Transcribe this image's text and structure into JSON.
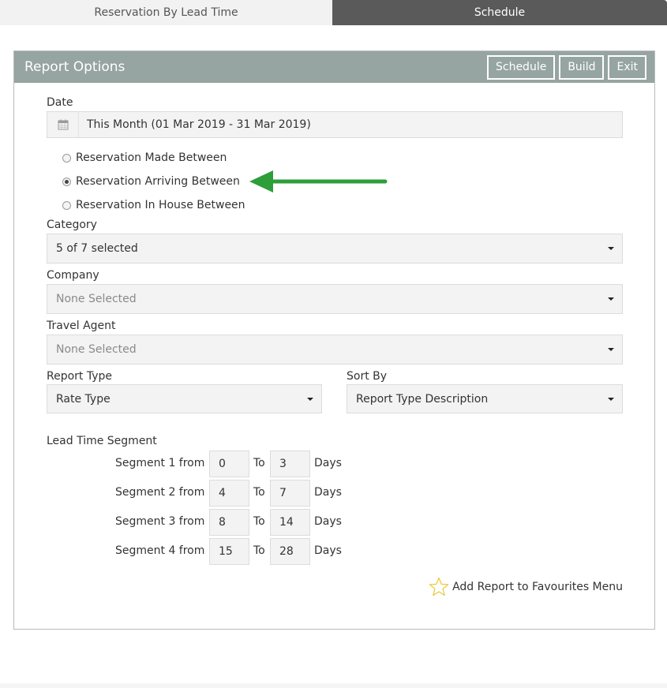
{
  "tabs": [
    {
      "label": "Reservation By Lead Time",
      "active": false
    },
    {
      "label": "Schedule",
      "active": true
    }
  ],
  "panel": {
    "title": "Report Options",
    "buttons": {
      "schedule": "Schedule",
      "build": "Build",
      "exit": "Exit"
    }
  },
  "date": {
    "label": "Date",
    "icon": "calendar-icon",
    "value": "This Month (01 Mar 2019 - 31 Mar 2019)"
  },
  "date_mode": {
    "options": [
      {
        "label": "Reservation Made Between",
        "checked": false
      },
      {
        "label": "Reservation Arriving Between",
        "checked": true
      },
      {
        "label": "Reservation In House Between",
        "checked": false
      }
    ],
    "annotation": "green-arrow-icon"
  },
  "category": {
    "label": "Category",
    "value": "5 of 7 selected"
  },
  "company": {
    "label": "Company",
    "placeholder": "None Selected"
  },
  "travel_agent": {
    "label": "Travel Agent",
    "placeholder": "None Selected"
  },
  "report_type": {
    "label": "Report Type",
    "value": "Rate Type"
  },
  "sort_by": {
    "label": "Sort By",
    "value": "Report Type Description"
  },
  "lead_time": {
    "label": "Lead Time Segment",
    "to_label": "To",
    "days_label": "Days",
    "segments": [
      {
        "label": "Segment 1 from",
        "from": "0",
        "to": "3"
      },
      {
        "label": "Segment 2 from",
        "from": "4",
        "to": "7"
      },
      {
        "label": "Segment 3 from",
        "from": "8",
        "to": "14"
      },
      {
        "label": "Segment 4 from",
        "from": "15",
        "to": "28"
      }
    ]
  },
  "favourites": {
    "label": "Add Report to Favourites Menu",
    "icon": "star-outline-icon"
  },
  "colors": {
    "header_bg": "#96a4a2",
    "active_tab_bg": "#5a5a5a",
    "arrow": "#2e9e3a",
    "star": "#e8c93a"
  }
}
